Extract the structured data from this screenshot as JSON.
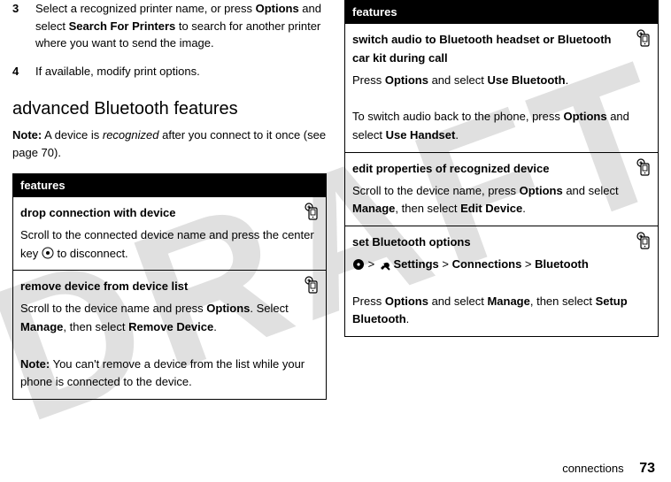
{
  "left": {
    "step3": {
      "num": "3",
      "text_before": "Select a recognized printer name, or press ",
      "options": "Options",
      "text_mid": " and select ",
      "search": "Search For Printers",
      "text_after": " to search for another printer where you want to send the image."
    },
    "step4": {
      "num": "4",
      "text": "If available, modify print options."
    },
    "heading": "advanced Bluetooth features",
    "note_label": "Note:",
    "note_before": " A device is ",
    "note_italic": "recognized",
    "note_after": " after you connect to it once (see page 70).",
    "table_header": "features",
    "drop": {
      "title": "drop connection with device",
      "before": "Scroll to the connected device name and press the center key ",
      "after": " to disconnect."
    },
    "remove": {
      "title": "remove device from device list",
      "line1_before": "Scroll to the device name and press ",
      "options": "Options",
      "line1_mid": ". Select ",
      "manage": "Manage",
      "line1_mid2": ", then select ",
      "removedev": "Remove Device",
      "line1_after": ".",
      "note_label": "Note:",
      "note_text": " You can't remove a device from the list while your phone is connected to the device."
    }
  },
  "right": {
    "table_header": "features",
    "switchaudio": {
      "title": "switch audio to Bluetooth headset or Bluetooth car kit during call",
      "l1_before": "Press ",
      "options": "Options",
      "l1_mid": " and select ",
      "usebt": "Use Bluetooth",
      "l1_after": ".",
      "l2_before": "To switch audio back to the phone, press ",
      "l2_mid": " and select ",
      "usehand": "Use Handset",
      "l2_after": "."
    },
    "editprops": {
      "title": "edit properties of recognized device",
      "before": "Scroll to the device name, press ",
      "options": "Options",
      "mid": " and select ",
      "manage": "Manage",
      "mid2": ", then select ",
      "editdev": "Edit Device",
      "after": "."
    },
    "setbt": {
      "title": "set Bluetooth options",
      "settings": "Settings",
      "gt1": " > ",
      "conn": "Connections",
      "gt2": " > ",
      "bt": "Bluetooth",
      "l2_before": "Press ",
      "options": "Options",
      "l2_mid": " and select ",
      "manage": "Manage",
      "l2_mid2": ", then select ",
      "setup": "Setup Bluetooth",
      "l2_after": "."
    }
  },
  "footer": {
    "section": "connections",
    "page": "73"
  }
}
